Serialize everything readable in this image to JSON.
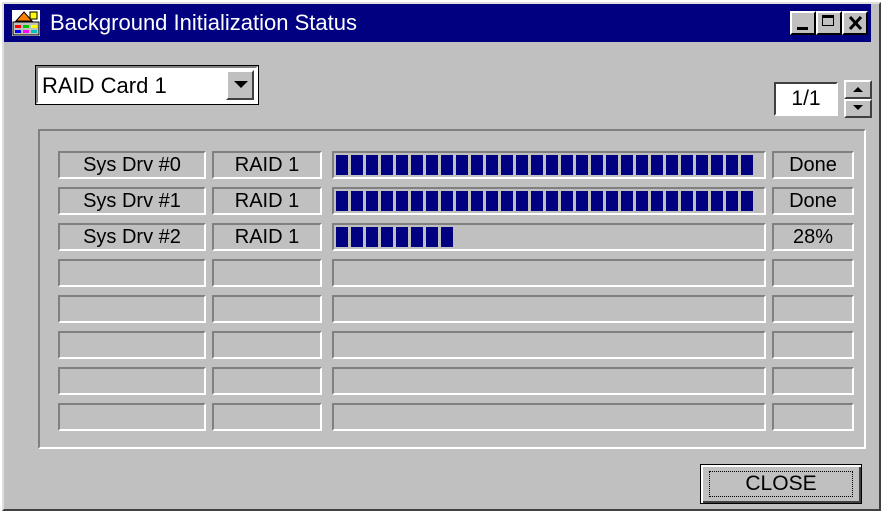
{
  "window": {
    "title": "Background Initialization Status",
    "icon": "raid-array-icon",
    "controls": {
      "minimize": "minimize-icon",
      "maximize": "maximize-icon",
      "close": "close-icon"
    }
  },
  "controller_select": {
    "value": "RAID Card 1",
    "icon": "chevron-down-icon"
  },
  "pager": {
    "value": "1/1"
  },
  "rows": [
    {
      "name": "Sys Drv #0",
      "raid": "RAID 1",
      "progress": 1.0,
      "status": "Done"
    },
    {
      "name": "Sys Drv #1",
      "raid": "RAID 1",
      "progress": 1.0,
      "status": "Done"
    },
    {
      "name": "Sys Drv #2",
      "raid": "RAID 1",
      "progress": 0.28,
      "status": "28%"
    },
    {
      "name": "",
      "raid": "",
      "progress": 0,
      "status": ""
    },
    {
      "name": "",
      "raid": "",
      "progress": 0,
      "status": ""
    },
    {
      "name": "",
      "raid": "",
      "progress": 0,
      "status": ""
    },
    {
      "name": "",
      "raid": "",
      "progress": 0,
      "status": ""
    },
    {
      "name": "",
      "raid": "",
      "progress": 0,
      "status": ""
    }
  ],
  "footer": {
    "close_label": "CLOSE"
  },
  "colors": {
    "title_bar": "#000080",
    "face": "#c0c0c0",
    "progress": "#000080"
  }
}
